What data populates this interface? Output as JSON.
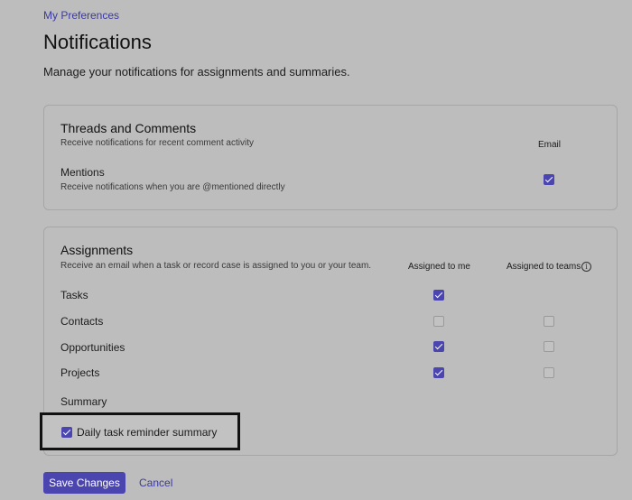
{
  "breadcrumb": "My Preferences",
  "page_title": "Notifications",
  "subtitle": "Manage your notifications for assignments and summaries.",
  "threads": {
    "title": "Threads and Comments",
    "description": "Receive notifications for recent comment activity",
    "email_header": "Email",
    "mentions": {
      "label": "Mentions",
      "description": "Receive notifications when you are @mentioned directly",
      "email_checked": true
    }
  },
  "assignments": {
    "title": "Assignments",
    "description": "Receive an email when a task or record case is assigned to you or your team.",
    "col_me": "Assigned to me",
    "col_teams": "Assigned to teams",
    "rows": [
      {
        "label": "Tasks",
        "me": true,
        "teams": null
      },
      {
        "label": "Contacts",
        "me": false,
        "teams": false
      },
      {
        "label": "Opportunities",
        "me": true,
        "teams": false
      },
      {
        "label": "Projects",
        "me": true,
        "teams": false
      }
    ],
    "summary_label": "Summary",
    "daily_summary": {
      "label": "Daily task reminder summary",
      "checked": true
    }
  },
  "actions": {
    "save_label": "Save Changes",
    "cancel_label": "Cancel"
  },
  "colors": {
    "accent": "#4b45b0",
    "background": "#bdbdbd"
  }
}
